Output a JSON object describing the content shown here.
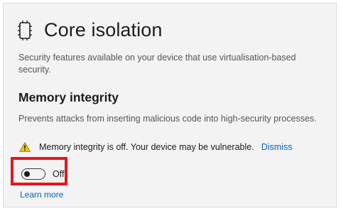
{
  "header": {
    "icon": "chip-icon",
    "title": "Core isolation"
  },
  "description": "Security features available on your device that use virtualisation-based security.",
  "memory_integrity": {
    "title": "Memory integrity",
    "description": "Prevents attacks from inserting malicious code into high-security processes.",
    "warning": {
      "icon": "warning-icon",
      "text": "Memory integrity is off. Your device may be vulnerable.",
      "dismiss_label": "Dismiss"
    },
    "toggle": {
      "state": "off",
      "label": "Off"
    },
    "learn_more_label": "Learn more"
  },
  "colors": {
    "link": "#0067c0",
    "highlight": "#e8141e",
    "warning": "#f0c419"
  }
}
